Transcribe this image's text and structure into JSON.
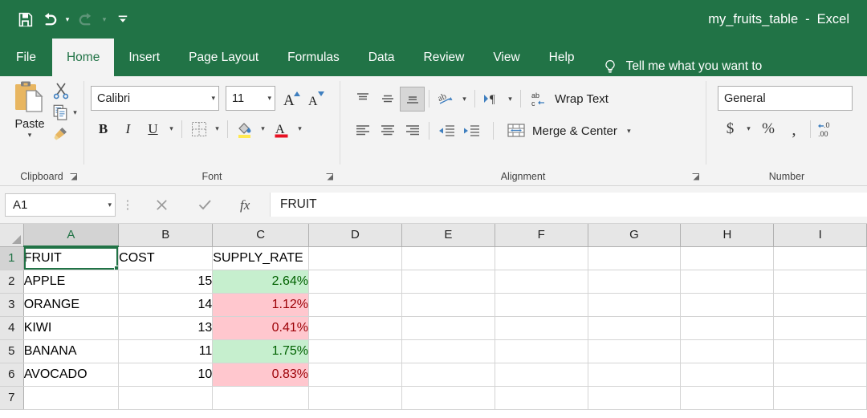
{
  "titlebar": {
    "document_name": "my_fruits_table",
    "separator": "-",
    "app_name": "Excel",
    "qat": [
      {
        "name": "save",
        "label": "Save"
      },
      {
        "name": "undo",
        "label": "Undo"
      },
      {
        "name": "redo",
        "label": "Redo"
      },
      {
        "name": "customize-quick-access-toolbar",
        "label": "Customize Quick Access Toolbar"
      }
    ]
  },
  "tabs": [
    {
      "label": "File",
      "active": false
    },
    {
      "label": "Home",
      "active": true
    },
    {
      "label": "Insert",
      "active": false
    },
    {
      "label": "Page Layout",
      "active": false
    },
    {
      "label": "Formulas",
      "active": false
    },
    {
      "label": "Data",
      "active": false
    },
    {
      "label": "Review",
      "active": false
    },
    {
      "label": "View",
      "active": false
    },
    {
      "label": "Help",
      "active": false
    }
  ],
  "tell_me": {
    "text": "Tell me what you want to",
    "icon": "lightbulb-icon"
  },
  "ribbon": {
    "clipboard": {
      "label": "Clipboard",
      "paste_label": "Paste",
      "cut_label": "Cut",
      "copy_label": "Copy",
      "format_painter_label": "Format Painter"
    },
    "font": {
      "label": "Font",
      "font_name": "Calibri",
      "font_size": "11",
      "grow_font_label": "Increase Font Size",
      "shrink_font_label": "Decrease Font Size",
      "bold_label": "B",
      "italic_label": "I",
      "underline_label": "U",
      "borders_label": "Borders",
      "fill_color_label": "Fill Color",
      "font_color_label": "Font Color"
    },
    "alignment": {
      "label": "Alignment",
      "top_align_label": "Top Align",
      "middle_align_label": "Middle Align",
      "bottom_align_label": "Bottom Align",
      "orientation_label": "Orientation",
      "text_direction_label": "Text Direction",
      "wrap_text_label": "Wrap Text",
      "align_left_label": "Align Left",
      "center_label": "Center",
      "align_right_label": "Align Right",
      "decrease_indent_label": "Decrease Indent",
      "increase_indent_label": "Increase Indent",
      "merge_center_label": "Merge & Center"
    },
    "number": {
      "label": "Number",
      "format": "General",
      "accounting_label": "Accounting Number Format",
      "percent_label": "Percent Style",
      "comma_label": "Comma Style",
      "increase_decimal_label": "Increase Decimal"
    }
  },
  "formula_bar": {
    "name_box": "A1",
    "cancel_label": "Cancel",
    "enter_label": "Enter",
    "insert_function_label": "Insert Function",
    "formula": "FRUIT"
  },
  "sheet": {
    "columns": [
      "A",
      "B",
      "C",
      "D",
      "E",
      "F",
      "G",
      "H",
      "I"
    ],
    "selected_cell": "A1",
    "rows": [
      {
        "num": "1",
        "cells": [
          {
            "col": "A",
            "value": "FRUIT",
            "style": "text",
            "selected": true
          },
          {
            "col": "B",
            "value": "COST",
            "style": "text"
          },
          {
            "col": "C",
            "value": "SUPPLY_RATE",
            "style": "text"
          },
          {
            "col": "D",
            "value": "",
            "style": "empty"
          },
          {
            "col": "E",
            "value": "",
            "style": "empty"
          },
          {
            "col": "F",
            "value": "",
            "style": "empty"
          },
          {
            "col": "G",
            "value": "",
            "style": "empty"
          },
          {
            "col": "H",
            "value": "",
            "style": "empty"
          },
          {
            "col": "I",
            "value": "",
            "style": "empty"
          }
        ]
      },
      {
        "num": "2",
        "cells": [
          {
            "col": "A",
            "value": "APPLE",
            "style": "text"
          },
          {
            "col": "B",
            "value": "15",
            "style": "num"
          },
          {
            "col": "C",
            "value": "2.64%",
            "style": "green"
          },
          {
            "col": "D",
            "value": "",
            "style": "empty"
          },
          {
            "col": "E",
            "value": "",
            "style": "empty"
          },
          {
            "col": "F",
            "value": "",
            "style": "empty"
          },
          {
            "col": "G",
            "value": "",
            "style": "empty"
          },
          {
            "col": "H",
            "value": "",
            "style": "empty"
          },
          {
            "col": "I",
            "value": "",
            "style": "empty"
          }
        ]
      },
      {
        "num": "3",
        "cells": [
          {
            "col": "A",
            "value": "ORANGE",
            "style": "text"
          },
          {
            "col": "B",
            "value": "14",
            "style": "num"
          },
          {
            "col": "C",
            "value": "1.12%",
            "style": "red"
          },
          {
            "col": "D",
            "value": "",
            "style": "empty"
          },
          {
            "col": "E",
            "value": "",
            "style": "empty"
          },
          {
            "col": "F",
            "value": "",
            "style": "empty"
          },
          {
            "col": "G",
            "value": "",
            "style": "empty"
          },
          {
            "col": "H",
            "value": "",
            "style": "empty"
          },
          {
            "col": "I",
            "value": "",
            "style": "empty"
          }
        ]
      },
      {
        "num": "4",
        "cells": [
          {
            "col": "A",
            "value": "KIWI",
            "style": "text"
          },
          {
            "col": "B",
            "value": "13",
            "style": "num"
          },
          {
            "col": "C",
            "value": "0.41%",
            "style": "red"
          },
          {
            "col": "D",
            "value": "",
            "style": "empty"
          },
          {
            "col": "E",
            "value": "",
            "style": "empty"
          },
          {
            "col": "F",
            "value": "",
            "style": "empty"
          },
          {
            "col": "G",
            "value": "",
            "style": "empty"
          },
          {
            "col": "H",
            "value": "",
            "style": "empty"
          },
          {
            "col": "I",
            "value": "",
            "style": "empty"
          }
        ]
      },
      {
        "num": "5",
        "cells": [
          {
            "col": "A",
            "value": "BANANA",
            "style": "text"
          },
          {
            "col": "B",
            "value": "11",
            "style": "num"
          },
          {
            "col": "C",
            "value": "1.75%",
            "style": "green"
          },
          {
            "col": "D",
            "value": "",
            "style": "empty"
          },
          {
            "col": "E",
            "value": "",
            "style": "empty"
          },
          {
            "col": "F",
            "value": "",
            "style": "empty"
          },
          {
            "col": "G",
            "value": "",
            "style": "empty"
          },
          {
            "col": "H",
            "value": "",
            "style": "empty"
          },
          {
            "col": "I",
            "value": "",
            "style": "empty"
          }
        ]
      },
      {
        "num": "6",
        "cells": [
          {
            "col": "A",
            "value": "AVOCADO",
            "style": "text"
          },
          {
            "col": "B",
            "value": "10",
            "style": "num"
          },
          {
            "col": "C",
            "value": "0.83%",
            "style": "red"
          },
          {
            "col": "D",
            "value": "",
            "style": "empty"
          },
          {
            "col": "E",
            "value": "",
            "style": "empty"
          },
          {
            "col": "F",
            "value": "",
            "style": "empty"
          },
          {
            "col": "G",
            "value": "",
            "style": "empty"
          },
          {
            "col": "H",
            "value": "",
            "style": "empty"
          },
          {
            "col": "I",
            "value": "",
            "style": "empty"
          }
        ]
      },
      {
        "num": "7",
        "cells": [
          {
            "col": "A",
            "value": "",
            "style": "empty"
          },
          {
            "col": "B",
            "value": "",
            "style": "empty"
          },
          {
            "col": "C",
            "value": "",
            "style": "empty"
          },
          {
            "col": "D",
            "value": "",
            "style": "empty"
          },
          {
            "col": "E",
            "value": "",
            "style": "empty"
          },
          {
            "col": "F",
            "value": "",
            "style": "empty"
          },
          {
            "col": "G",
            "value": "",
            "style": "empty"
          },
          {
            "col": "H",
            "value": "",
            "style": "empty"
          },
          {
            "col": "I",
            "value": "",
            "style": "empty"
          }
        ]
      }
    ]
  },
  "colors": {
    "brand_green": "#217346",
    "conditional_green_fill": "#C6EFCE",
    "conditional_green_text": "#006100",
    "conditional_red_fill": "#FFC7CE",
    "conditional_red_text": "#9C0006"
  }
}
